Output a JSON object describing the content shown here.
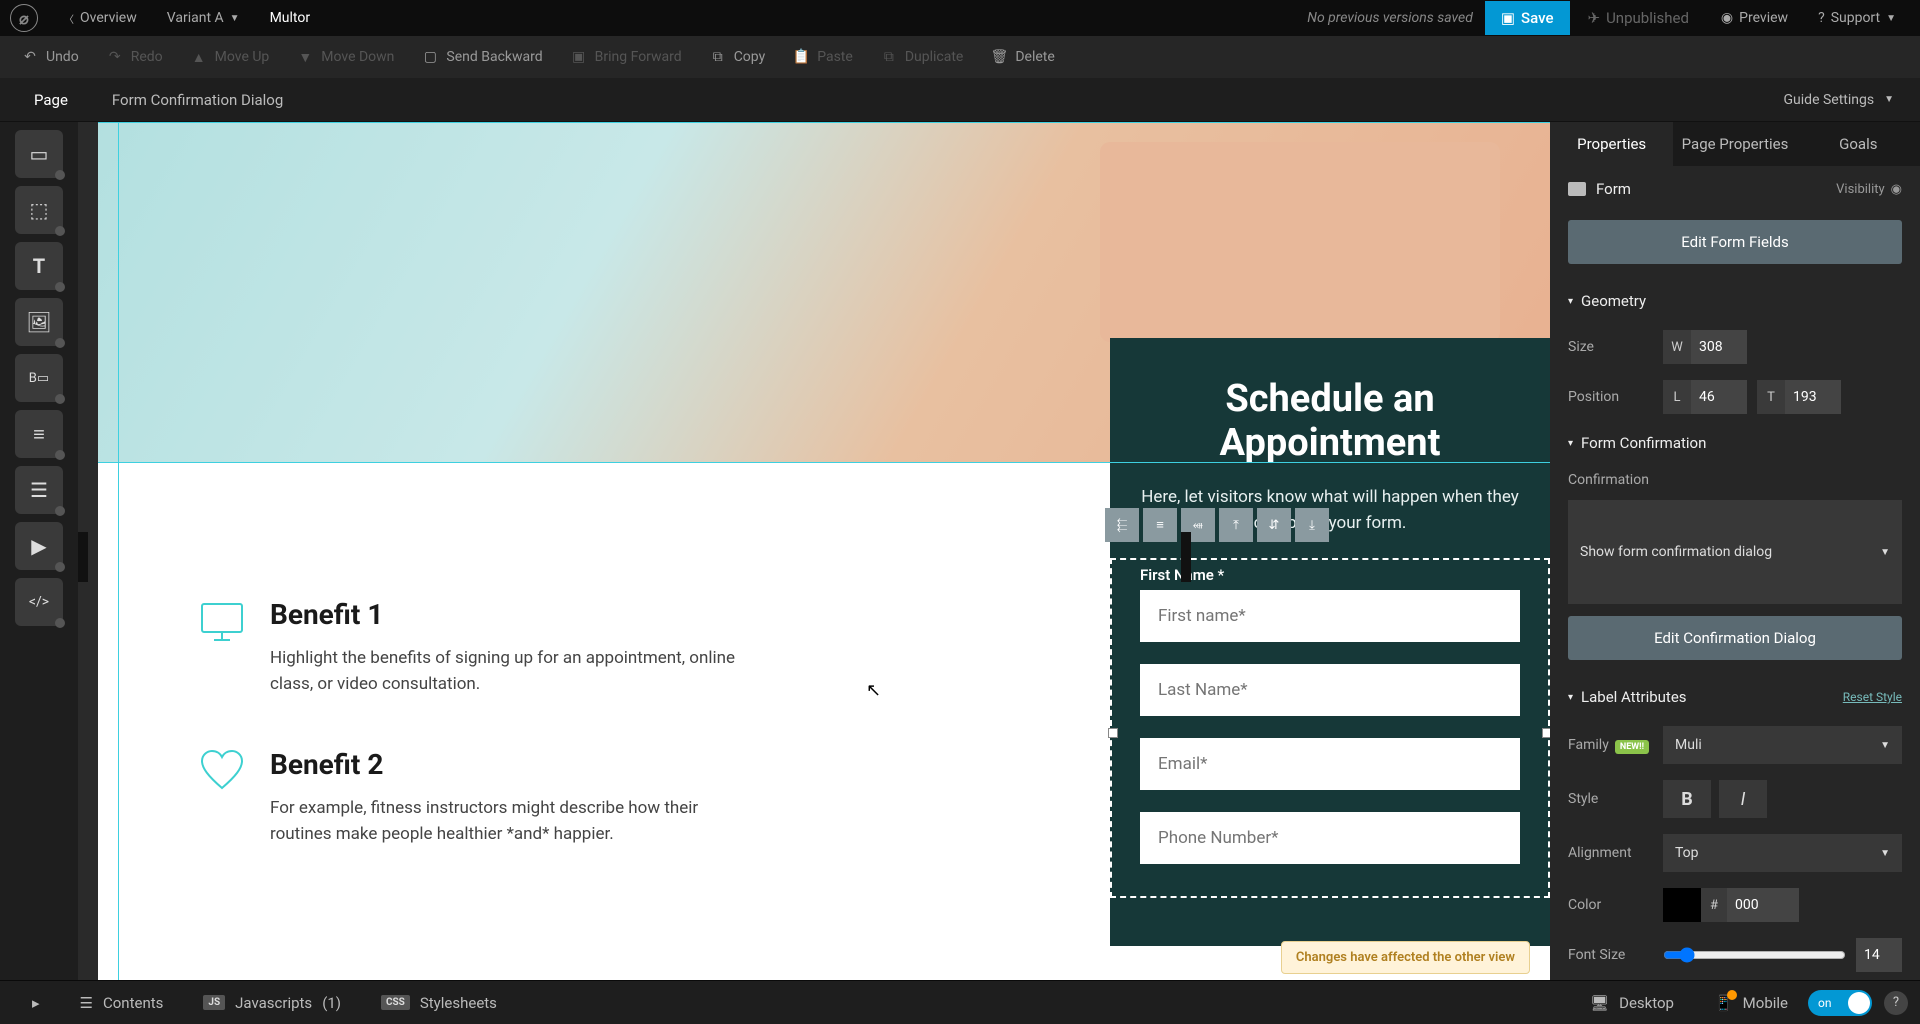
{
  "topbar": {
    "overview": "Overview",
    "variant": "Variant A",
    "page_name": "Multor",
    "status": "No previous versions saved",
    "save": "Save",
    "unpublished": "Unpublished",
    "preview": "Preview",
    "support": "Support"
  },
  "actions": {
    "undo": "Undo",
    "redo": "Redo",
    "move_up": "Move Up",
    "move_down": "Move Down",
    "send_backward": "Send Backward",
    "bring_forward": "Bring Forward",
    "copy": "Copy",
    "paste": "Paste",
    "duplicate": "Duplicate",
    "delete": "Delete"
  },
  "subheader": {
    "page": "Page",
    "dialog": "Form Confirmation Dialog",
    "guide": "Guide Settings"
  },
  "canvas": {
    "form_title": "Schedule an Appointment",
    "form_sub": "Here, let visitors know what will happen when they complete your form.",
    "label_first": "First Name *",
    "ph_first": "First name*",
    "ph_last": "Last Name*",
    "ph_email": "Email*",
    "ph_phone": "Phone Number*",
    "b1_title": "Benefit 1",
    "b1_text": "Highlight the benefits of signing up for an appointment, online class, or video consultation.",
    "b2_title": "Benefit 2",
    "b2_text": "For example, fitness instructors might describe how their routines make people healthier *and* happier.",
    "toast": "Changes have affected the other view"
  },
  "panel": {
    "tabs": {
      "properties": "Properties",
      "page_props": "Page Properties",
      "goals": "Goals"
    },
    "element": "Form",
    "visibility": "Visibility",
    "edit_fields": "Edit Form Fields",
    "geometry": "Geometry",
    "size_label": "Size",
    "size_w": "308",
    "pos_label": "Position",
    "pos_l": "46",
    "pos_t": "193",
    "fc_header": "Form Confirmation",
    "fc_conf_label": "Confirmation",
    "fc_conf_value": "Show form confirmation dialog",
    "fc_edit": "Edit Confirmation Dialog",
    "la_header": "Label Attributes",
    "reset": "Reset Style",
    "family_label": "Family",
    "new_badge": "NEW!!",
    "family_value": "Muli",
    "style_label": "Style",
    "align_label": "Alignment",
    "align_value": "Top",
    "color_label": "Color",
    "color_value": "000",
    "fontsize_label": "Font Size",
    "fontsize_value": "14"
  },
  "bottombar": {
    "contents": "Contents",
    "js": "Javascripts",
    "js_count": "(1)",
    "css": "Stylesheets",
    "desktop": "Desktop",
    "mobile": "Mobile",
    "toggle": "on"
  }
}
